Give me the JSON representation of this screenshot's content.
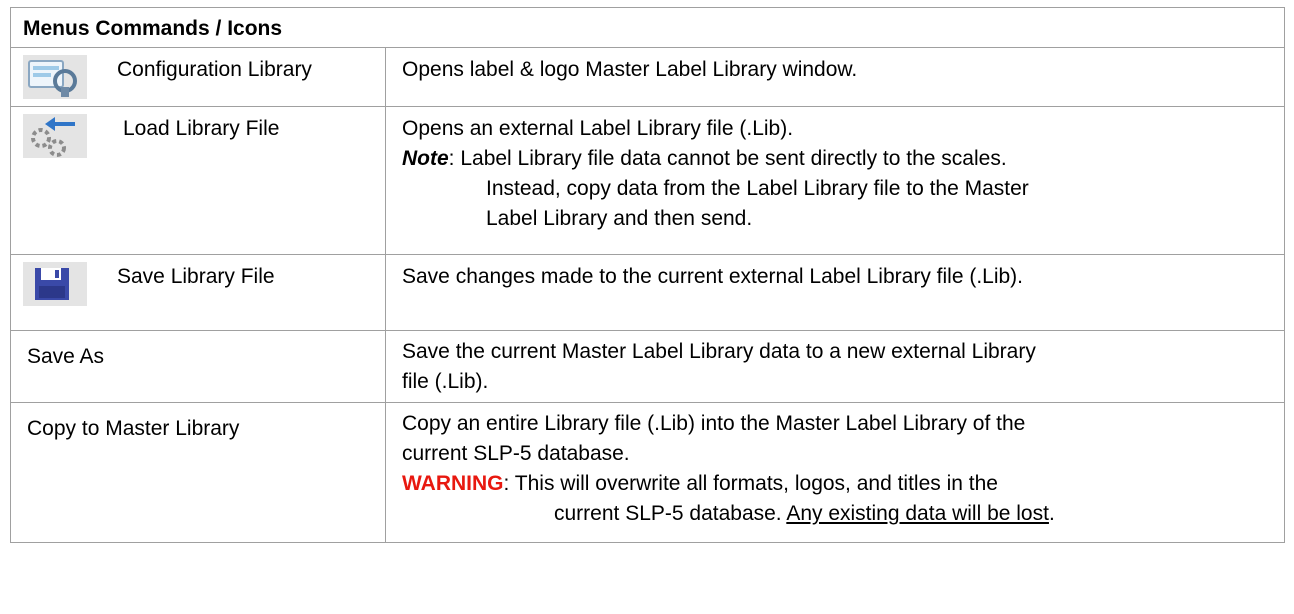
{
  "table": {
    "header": "Menus Commands / Icons",
    "rows": [
      {
        "command": "Configuration Library",
        "icon": "configuration-library-icon",
        "description": [
          "Opens label & logo Master Label Library window."
        ]
      },
      {
        "command": "Load Library File",
        "icon": "load-library-file-icon",
        "description": [
          "Opens an external Label Library file (.Lib)."
        ],
        "note_label": "Note",
        "note_text": ": Label Library file data cannot be sent directly to the scales.",
        "note_cont_1": "Instead, copy data from the Label Library file to the Master",
        "note_cont_2": "Label Library and then send."
      },
      {
        "command": "Save Library File",
        "icon": "save-library-file-icon",
        "description": [
          "Save changes made to the current external Label Library file (.Lib)."
        ]
      },
      {
        "command": "Save As",
        "description": [
          "Save the current Master Label Library data to a new external Library",
          "file (.Lib)."
        ]
      },
      {
        "command": "Copy to Master Library",
        "description": [
          "Copy an entire Library file (.Lib) into the Master Label Library of the",
          "current SLP-5 database."
        ],
        "warning_label": "WARNING",
        "warning_text": ": This will overwrite all formats, logos, and titles in the",
        "warning_cont_plain": "current SLP-5 database. ",
        "warning_cont_underlined": "Any existing data will be lost",
        "warning_cont_end": "."
      }
    ]
  },
  "colors": {
    "warning": "#e8180f",
    "border": "#a0a0a0"
  }
}
